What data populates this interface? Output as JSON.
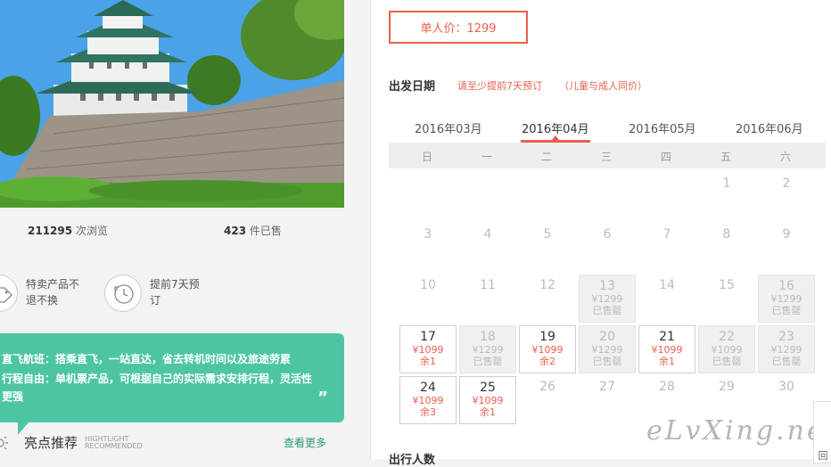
{
  "stats": {
    "views_count": "211295",
    "views_label": "次浏览",
    "sold_count": "423",
    "sold_label": "件已售"
  },
  "badges": [
    {
      "icon": "tag-icon",
      "text_line1": "特卖产品不",
      "text_line2": "退不换"
    },
    {
      "icon": "clock-icon",
      "text_line1": "提前7天预",
      "text_line2": "订"
    }
  ],
  "features": {
    "line1": "直飞航班：搭乘直飞，一站直达，省去转机时间以及旅途劳累",
    "line2": "行程自由：单机票产品，可根据自己的实际需求安排行程，灵活性",
    "line3": "更强",
    "quote_mark": "”"
  },
  "highlights": {
    "title": "亮点推荐",
    "sub_line1": "HIGHTLIGHT",
    "sub_line2": "RECOMMENDED",
    "more": "查看更多"
  },
  "price": {
    "label": "单人价：1299"
  },
  "departure": {
    "label": "出发日期",
    "note1": "请至少提前7天预订",
    "note2": "（儿童与成人同价）"
  },
  "months": [
    "2016年03月",
    "2016年04月",
    "2016年05月",
    "2016年06月"
  ],
  "active_month_index": 1,
  "weekdays": [
    "日",
    "一",
    "二",
    "三",
    "四",
    "五",
    "六"
  ],
  "calendar": [
    {
      "day": "1",
      "col": 5,
      "row": 0,
      "state": "empty"
    },
    {
      "day": "2",
      "col": 6,
      "row": 0,
      "state": "empty"
    },
    {
      "day": "3",
      "col": 0,
      "row": 1,
      "state": "empty"
    },
    {
      "day": "4",
      "col": 1,
      "row": 1,
      "state": "empty"
    },
    {
      "day": "5",
      "col": 2,
      "row": 1,
      "state": "empty"
    },
    {
      "day": "6",
      "col": 3,
      "row": 1,
      "state": "empty"
    },
    {
      "day": "7",
      "col": 4,
      "row": 1,
      "state": "empty"
    },
    {
      "day": "8",
      "col": 5,
      "row": 1,
      "state": "empty"
    },
    {
      "day": "9",
      "col": 6,
      "row": 1,
      "state": "empty"
    },
    {
      "day": "10",
      "col": 0,
      "row": 2,
      "state": "empty"
    },
    {
      "day": "11",
      "col": 1,
      "row": 2,
      "state": "empty"
    },
    {
      "day": "12",
      "col": 2,
      "row": 2,
      "state": "empty"
    },
    {
      "day": "13",
      "col": 3,
      "row": 2,
      "state": "sold",
      "price": "¥1299",
      "status": "已售罄"
    },
    {
      "day": "14",
      "col": 4,
      "row": 2,
      "state": "empty"
    },
    {
      "day": "15",
      "col": 5,
      "row": 2,
      "state": "empty"
    },
    {
      "day": "16",
      "col": 6,
      "row": 2,
      "state": "sold",
      "price": "¥1299",
      "status": "已售罄"
    },
    {
      "day": "17",
      "col": 0,
      "row": 3,
      "state": "avail",
      "price": "¥1099",
      "status": "余1"
    },
    {
      "day": "18",
      "col": 1,
      "row": 3,
      "state": "sold",
      "price": "¥1299",
      "status": "已售罄"
    },
    {
      "day": "19",
      "col": 2,
      "row": 3,
      "state": "avail",
      "price": "¥1099",
      "status": "余2"
    },
    {
      "day": "20",
      "col": 3,
      "row": 3,
      "state": "sold",
      "price": "¥1299",
      "status": "已售罄"
    },
    {
      "day": "21",
      "col": 4,
      "row": 3,
      "state": "avail",
      "price": "¥1099",
      "status": "余1"
    },
    {
      "day": "22",
      "col": 5,
      "row": 3,
      "state": "sold",
      "price": "¥1099",
      "status": "已售罄"
    },
    {
      "day": "23",
      "col": 6,
      "row": 3,
      "state": "sold",
      "price": "¥1299",
      "status": "已售罄"
    },
    {
      "day": "24",
      "col": 0,
      "row": 4,
      "state": "avail",
      "price": "¥1099",
      "status": "余3"
    },
    {
      "day": "25",
      "col": 1,
      "row": 4,
      "state": "avail",
      "price": "¥1099",
      "status": "余1"
    },
    {
      "day": "26",
      "col": 2,
      "row": 4,
      "state": "empty"
    },
    {
      "day": "27",
      "col": 3,
      "row": 4,
      "state": "empty"
    },
    {
      "day": "28",
      "col": 4,
      "row": 4,
      "state": "empty"
    },
    {
      "day": "29",
      "col": 5,
      "row": 4,
      "state": "empty"
    },
    {
      "day": "30",
      "col": 6,
      "row": 4,
      "state": "empty"
    }
  ],
  "people_label": "出行人数",
  "watermark": "eLvXing.net",
  "side_tab": "回",
  "colors": {
    "accent": "#e8604c",
    "green": "#4dc5a3",
    "more_link": "#2a9d6f"
  }
}
